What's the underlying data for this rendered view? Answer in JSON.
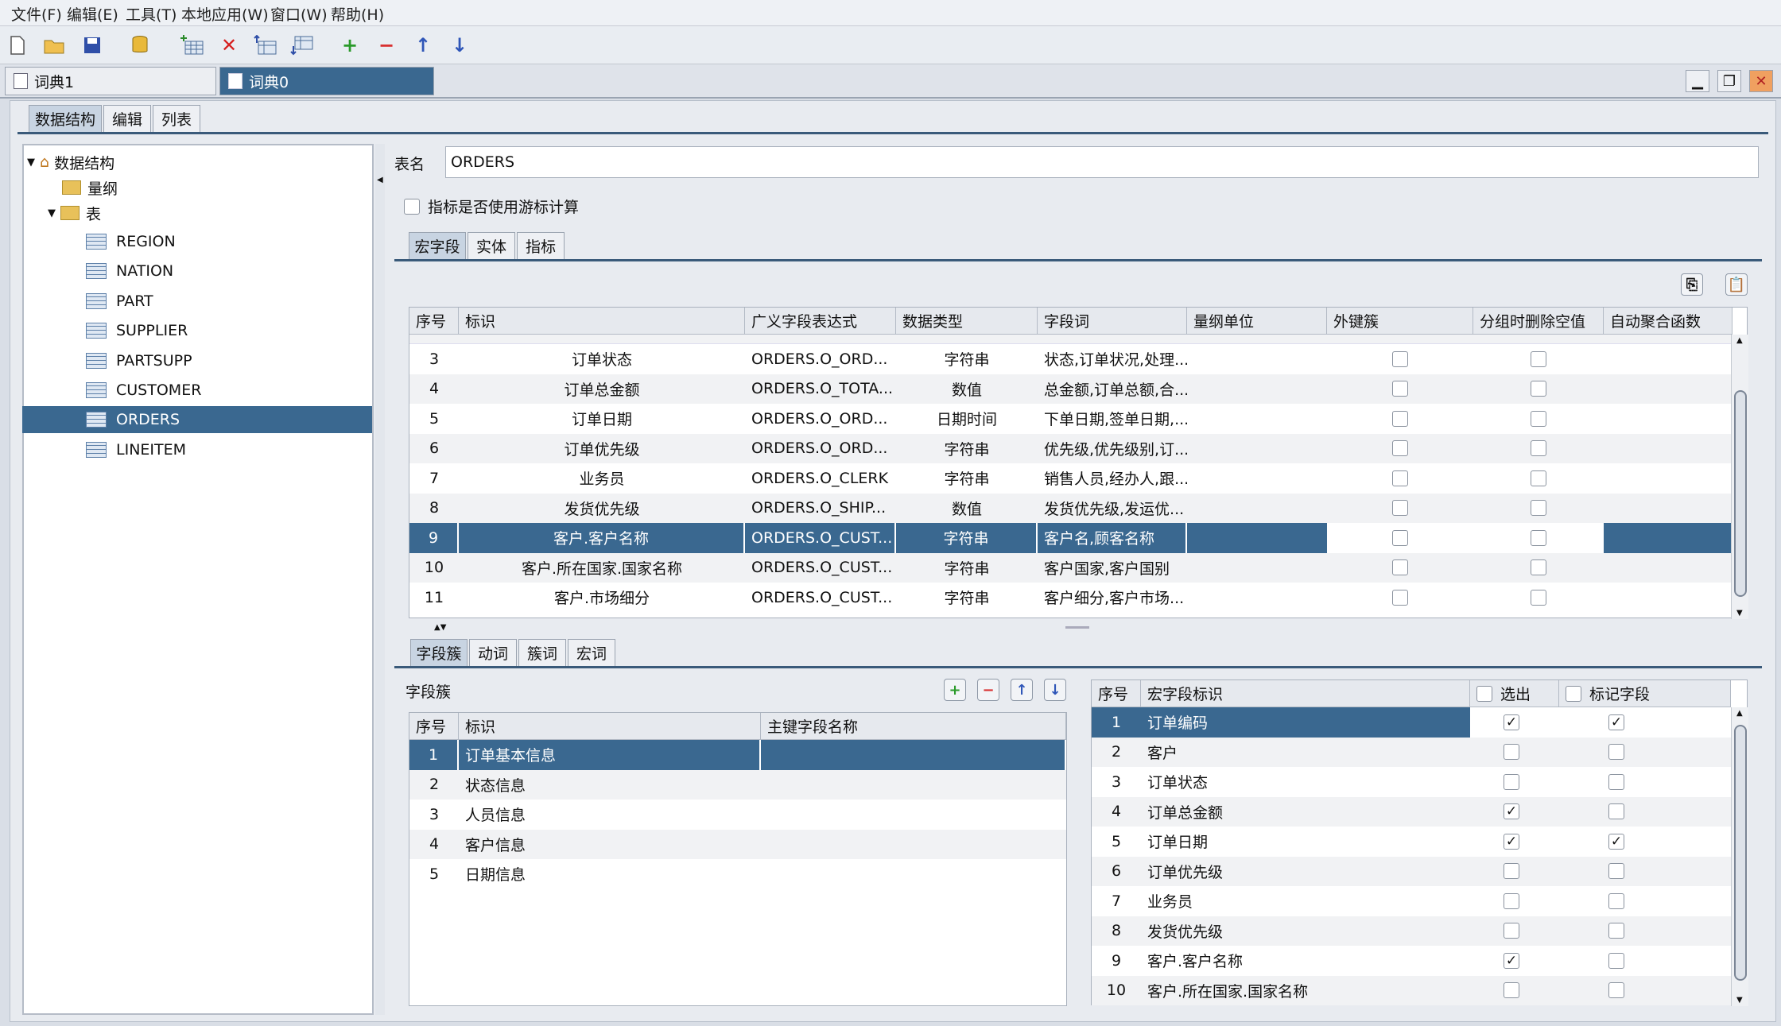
{
  "menu": [
    "文件(F)",
    "编辑(E)",
    "工具(T)",
    "本地应用(W)",
    "窗口(W)",
    "帮助(H)"
  ],
  "toolbar_icons": [
    "new-file-icon",
    "open-folder-icon",
    "save-icon",
    "database-icon",
    "add-table-icon",
    "delete-icon",
    "table-up-icon",
    "table-down-icon",
    "add-icon",
    "remove-icon",
    "arrow-up-icon",
    "arrow-down-icon"
  ],
  "doc_tabs": [
    "词典1",
    "词典0"
  ],
  "left_tabs": [
    "数据结构",
    "编辑",
    "列表"
  ],
  "tree": {
    "root": "数据结构",
    "dimension": "量纲",
    "table_folder": "表",
    "tables": [
      "REGION",
      "NATION",
      "PART",
      "SUPPLIER",
      "PARTSUPP",
      "CUSTOMER",
      "ORDERS",
      "LINEITEM"
    ],
    "selected": "ORDERS"
  },
  "table_name_label": "表名",
  "table_name_value": "ORDERS",
  "cursor_checkbox_label": "指标是否使用游标计算",
  "mid_tabs": [
    "宏字段",
    "实体",
    "指标"
  ],
  "macro_grid": {
    "headers": [
      "序号",
      "标识",
      "广义字段表达式",
      "数据类型",
      "字段词",
      "量纲单位",
      "外键簇",
      "分组时删除空值",
      "自动聚合函数"
    ],
    "rows": [
      {
        "no": "3",
        "id": "订单状态",
        "expr": "ORDERS.O_ORD...",
        "type": "字符串",
        "words": "状态,订单状况,处理...",
        "unit": "",
        "selected": false
      },
      {
        "no": "4",
        "id": "订单总金额",
        "expr": "ORDERS.O_TOTA...",
        "type": "数值",
        "words": "总金额,订单总额,合...",
        "unit": "",
        "selected": false
      },
      {
        "no": "5",
        "id": "订单日期",
        "expr": "ORDERS.O_ORD...",
        "type": "日期时间",
        "words": "下单日期,签单日期,...",
        "unit": "",
        "selected": false
      },
      {
        "no": "6",
        "id": "订单优先级",
        "expr": "ORDERS.O_ORD...",
        "type": "字符串",
        "words": "优先级,优先级别,订...",
        "unit": "",
        "selected": false
      },
      {
        "no": "7",
        "id": "业务员",
        "expr": "ORDERS.O_CLERK",
        "type": "字符串",
        "words": "销售人员,经办人,跟...",
        "unit": "",
        "selected": false
      },
      {
        "no": "8",
        "id": "发货优先级",
        "expr": "ORDERS.O_SHIP...",
        "type": "数值",
        "words": "发货优先级,发运优...",
        "unit": "",
        "selected": false
      },
      {
        "no": "9",
        "id": "客户.客户名称",
        "expr": "ORDERS.O_CUST...",
        "type": "字符串",
        "words": "客户名,顾客名称",
        "unit": "",
        "selected": true
      },
      {
        "no": "10",
        "id": "客户.所在国家.国家名称",
        "expr": "ORDERS.O_CUST...",
        "type": "字符串",
        "words": "客户国家,客户国别",
        "unit": "",
        "selected": false
      },
      {
        "no": "11",
        "id": "客户.市场细分",
        "expr": "ORDERS.O_CUST...",
        "type": "字符串",
        "words": "客户细分,客户市场...",
        "unit": "",
        "selected": false
      }
    ]
  },
  "bottom_tabs": [
    "字段簇",
    "动词",
    "簇词",
    "宏词"
  ],
  "cluster_panel": {
    "title": "字段簇",
    "headers": [
      "序号",
      "标识",
      "主键字段名称"
    ],
    "rows": [
      {
        "no": "1",
        "id": "订单基本信息",
        "key": "",
        "selected": true
      },
      {
        "no": "2",
        "id": "状态信息",
        "key": "",
        "selected": false
      },
      {
        "no": "3",
        "id": "人员信息",
        "key": "",
        "selected": false
      },
      {
        "no": "4",
        "id": "客户信息",
        "key": "",
        "selected": false
      },
      {
        "no": "5",
        "id": "日期信息",
        "key": "",
        "selected": false
      }
    ]
  },
  "field_panel": {
    "headers": [
      "序号",
      "宏字段标识",
      "选出",
      "标记字段"
    ],
    "rows": [
      {
        "no": "1",
        "id": "订单编码",
        "out": true,
        "mark": true,
        "selected": true
      },
      {
        "no": "2",
        "id": "客户",
        "out": false,
        "mark": false,
        "selected": false
      },
      {
        "no": "3",
        "id": "订单状态",
        "out": false,
        "mark": false,
        "selected": false
      },
      {
        "no": "4",
        "id": "订单总金额",
        "out": true,
        "mark": false,
        "selected": false
      },
      {
        "no": "5",
        "id": "订单日期",
        "out": true,
        "mark": true,
        "selected": false
      },
      {
        "no": "6",
        "id": "订单优先级",
        "out": false,
        "mark": false,
        "selected": false
      },
      {
        "no": "7",
        "id": "业务员",
        "out": false,
        "mark": false,
        "selected": false
      },
      {
        "no": "8",
        "id": "发货优先级",
        "out": false,
        "mark": false,
        "selected": false
      },
      {
        "no": "9",
        "id": "客户.客户名称",
        "out": true,
        "mark": false,
        "selected": false
      },
      {
        "no": "10",
        "id": "客户.所在国家.国家名称",
        "out": false,
        "mark": false,
        "selected": false
      }
    ]
  },
  "colors": {
    "selection": "#3a6890",
    "alt_row": "#f1f2f4"
  }
}
